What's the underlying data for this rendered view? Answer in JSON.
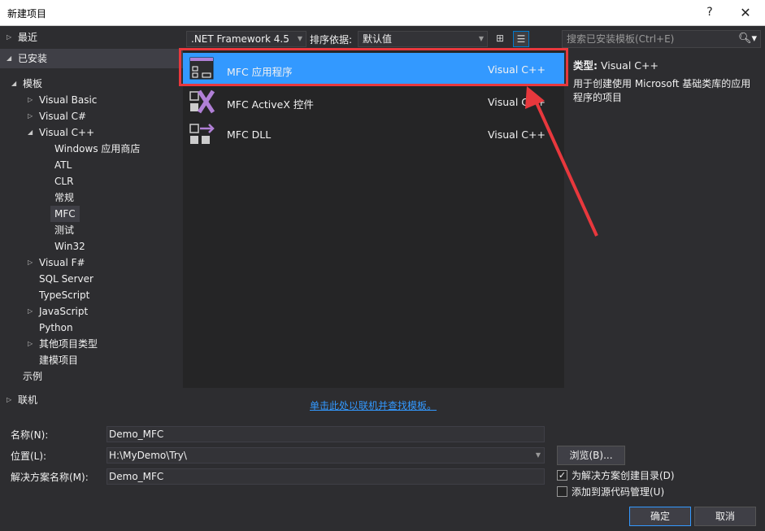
{
  "window": {
    "title": "新建项目",
    "help_label": "?",
    "close_label": "✕"
  },
  "tree": {
    "recent": "最近",
    "installed": "已安装",
    "templates": "模板",
    "visual_basic": "Visual Basic",
    "visual_csharp": "Visual C#",
    "visual_cpp": "Visual C++",
    "windows_store": "Windows 应用商店",
    "atl": "ATL",
    "clr": "CLR",
    "general": "常规",
    "mfc": "MFC",
    "test": "测试",
    "win32": "Win32",
    "visual_fsharp": "Visual F#",
    "sql_server": "SQL Server",
    "typescript": "TypeScript",
    "javascript": "JavaScript",
    "python": "Python",
    "other_types": "其他项目类型",
    "modeling": "建模项目",
    "samples": "示例",
    "online": "联机"
  },
  "toolbar": {
    "framework": ".NET Framework 4.5",
    "sort_label": "排序依据:",
    "sort_value": "默认值"
  },
  "templates": [
    {
      "name": "MFC 应用程序",
      "lang": "Visual C++"
    },
    {
      "name": "MFC ActiveX 控件",
      "lang": "Visual C++"
    },
    {
      "name": "MFC DLL",
      "lang": "Visual C++"
    }
  ],
  "online_link": "单击此处以联机并查找模板。",
  "search": {
    "placeholder": "搜索已安装模板(Ctrl+E)"
  },
  "info": {
    "type_label": "类型:",
    "type_value": "Visual C++",
    "description": "用于创建使用 Microsoft 基础类库的应用程序的项目"
  },
  "form": {
    "name_label": "名称(N):",
    "name_value": "Demo_MFC",
    "location_label": "位置(L):",
    "location_value": "H:\\MyDemo\\Try\\",
    "solution_label": "解决方案名称(M):",
    "solution_value": "Demo_MFC",
    "browse_label": "浏览(B)...",
    "create_dir_label": "为解决方案创建目录(D)",
    "create_dir_checked": true,
    "source_control_label": "添加到源代码管理(U)",
    "source_control_checked": false,
    "ok_label": "确定",
    "cancel_label": "取消"
  },
  "colors": {
    "accent": "#3399ff",
    "highlight": "#e8383d",
    "icon_purple": "#b180d7"
  }
}
